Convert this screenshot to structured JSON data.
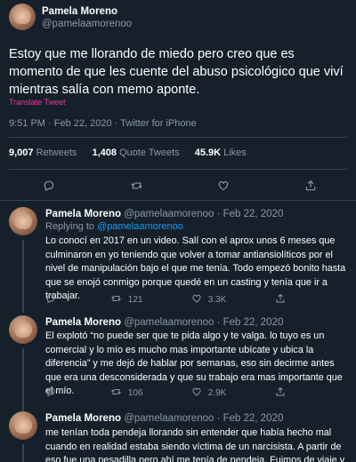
{
  "main": {
    "name": "Pamela Moreno",
    "handle": "@pamelaamorenoo",
    "text": "Estoy que me llorando de miedo pero creo que es momento de que les cuente del abuso psicológico que viví mientras salía con memo aponte.",
    "translate": "Translate Tweet",
    "meta": "9:51 PM · Feb 22, 2020 · Twitter for iPhone",
    "stats": [
      {
        "value": "9,007",
        "label": "Retweets"
      },
      {
        "value": "1,408",
        "label": "Quote Tweets"
      },
      {
        "value": "45.9K",
        "label": "Likes"
      }
    ]
  },
  "replies": [
    {
      "name": "Pamela Moreno",
      "handle_date": "@pamelaamorenoo · Feb 22, 2020",
      "replying_label": "Replying to",
      "replying_to": "@pamelaamorenoo",
      "text": "Lo conocí en 2017 en un video. Salí con el aprox unos 6 meses que culminaron en yo teniendo que volver a tomar antiansiolíticos por el nivel de manipulación bajo el que me tenía. Todo empezó bonito hasta que se enojó conmigo porque quedé en un casting y tenía que ir a trabajar.",
      "retweets": "121",
      "likes": "3.3K"
    },
    {
      "name": "Pamela Moreno",
      "handle_date": "@pamelaamorenoo · Feb 22, 2020",
      "text": "El explotó “no puede ser que te pida algo y te valga. lo tuyo es un comercial y lo mío es mucho mas importante ubícate y ubica la diferencia” y me dejó de hablar por semanas, eso sin decirme antes que era una desconsiderada y que su trabajo era mas importante que el mío.",
      "retweets": "106",
      "likes": "2.9K"
    },
    {
      "name": "Pamela Moreno",
      "handle_date": "@pamelaamorenoo · Feb 22, 2020",
      "text": "me tenían toda pendeja llorando sin entender que había hecho mal cuando en realidad estaba siendo víctima de un narcisista. A partir de eso fue una pesadilla pero ahí me tenía de pendeja. Fuimos de viaje y mientras el"
    }
  ]
}
